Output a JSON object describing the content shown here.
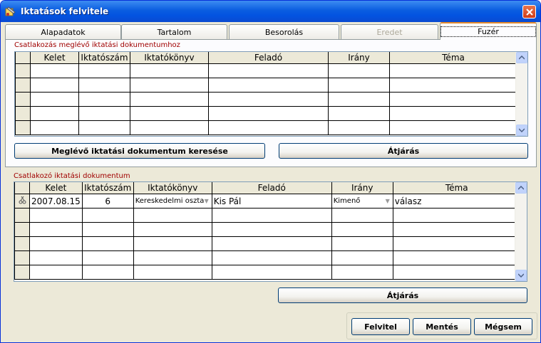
{
  "window": {
    "title": "Iktatások felvitele"
  },
  "tabs": [
    {
      "label": "Alapadatok"
    },
    {
      "label": "Tartalom"
    },
    {
      "label": "Besorolás"
    },
    {
      "label": "Eredet"
    },
    {
      "label": "Fuzér"
    }
  ],
  "section1": {
    "label": "Csatlakozás meglévő iktatási dokumentumhoz",
    "columns": [
      "Kelet",
      "Iktatószám",
      "Iktatókönyv",
      "Feladó",
      "Irány",
      "Téma"
    ],
    "search_button": "Meglévő iktatási dokumentum keresése",
    "goto_button": "Átjárás"
  },
  "section2": {
    "label": "Csatlakozó iktatási dokumentum",
    "columns": [
      "Kelet",
      "Iktatószám",
      "Iktatókönyv",
      "Feladó",
      "Irány",
      "Téma"
    ],
    "row": {
      "kelet": "2007.08.15",
      "iktatoszam": "6",
      "iktatokonyv": "Kereskedelmi oszta",
      "felado": "Kis Pál",
      "irany": "Kimenő",
      "tema": "válasz"
    },
    "goto_button": "Átjárás"
  },
  "footer": {
    "felvitel": "Felvitel",
    "mentes": "Mentés",
    "megsem": "Mégsem"
  }
}
